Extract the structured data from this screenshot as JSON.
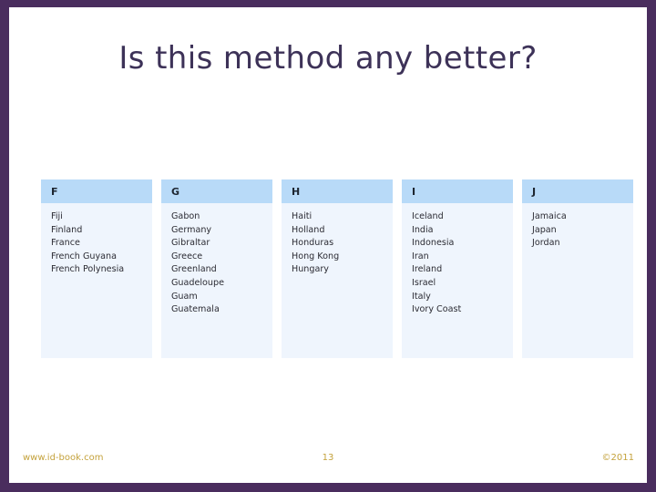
{
  "slide": {
    "title": "Is this method any better?",
    "accent_border_color": "#4a2d5e",
    "title_color": "#3d3258",
    "header_band_color": "#b8daf8",
    "column_body_color": "#eff5fd",
    "footer_text_color": "#c4a23c"
  },
  "table": {
    "columns": [
      {
        "letter": "F",
        "items": [
          "Fiji",
          "Finland",
          "France",
          "French Guyana",
          "French Polynesia"
        ]
      },
      {
        "letter": "G",
        "items": [
          "Gabon",
          "Germany",
          "Gibraltar",
          "Greece",
          "Greenland",
          "Guadeloupe",
          "Guam",
          "Guatemala"
        ]
      },
      {
        "letter": "H",
        "items": [
          "Haiti",
          "Holland",
          "Honduras",
          "Hong Kong",
          "Hungary"
        ]
      },
      {
        "letter": "I",
        "items": [
          "Iceland",
          "India",
          "Indonesia",
          "Iran",
          "Ireland",
          "Israel",
          "Italy",
          "Ivory Coast"
        ]
      },
      {
        "letter": "J",
        "items": [
          "Jamaica",
          "Japan",
          "Jordan"
        ]
      }
    ]
  },
  "footer": {
    "website": "www.id-book.com",
    "page_number": "13",
    "copyright": "©2011"
  }
}
